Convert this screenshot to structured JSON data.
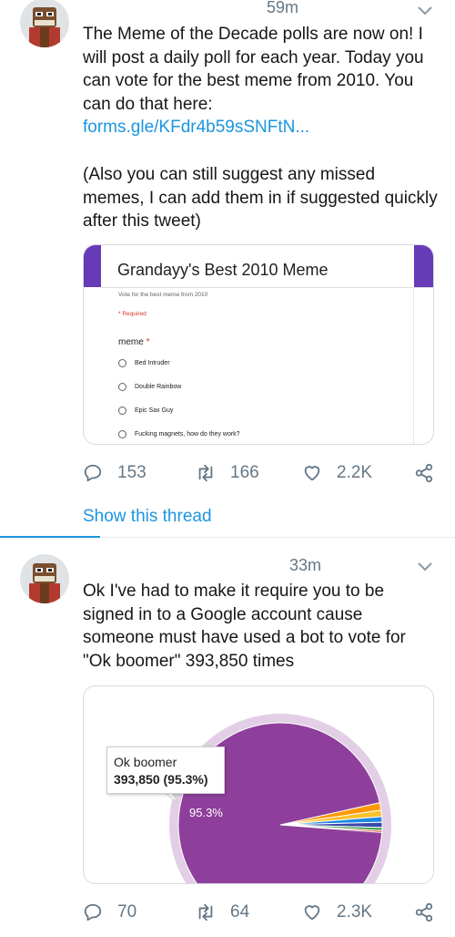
{
  "tweets": [
    {
      "time": "59m",
      "paragraphs": [
        "The Meme of the Decade polls are now on! I will post a daily poll for each year. Today you can vote for the best meme from 2010. You can do that here:",
        "(Also you can still suggest any missed memes, I can add them in if suggested quickly after this tweet)"
      ],
      "link": "forms.gle/KFdr4b59sSNFtN...",
      "form": {
        "title": "Grandayy's Best 2010 Meme",
        "subtitle": "Vote for the best meme from 2010",
        "required_note": "* Required",
        "question": "meme",
        "required_star": "*",
        "options": [
          "Bed Intruder",
          "Double Rainbow",
          "Epic Sax Guy",
          "Fucking magnets, how do they work?"
        ]
      },
      "actions": {
        "replies": "153",
        "retweets": "166",
        "likes": "2.2K"
      },
      "show_thread": "Show this thread"
    },
    {
      "time": "33m",
      "text": "Ok I've had to make it require you to be signed in to a Google account cause someone must have used a bot to vote for \"Ok boomer\" 393,850 times",
      "actions": {
        "replies": "70",
        "retweets": "64",
        "likes": "2.3K"
      }
    }
  ],
  "chart_data": {
    "type": "pie",
    "slices": [
      {
        "label": "Ok boomer",
        "value": 393850,
        "percent": 95.3,
        "color": "#8e3f9b"
      },
      {
        "label": "",
        "percent": 1.2,
        "color": "#ff9800"
      },
      {
        "label": "",
        "percent": 1.0,
        "color": "#fbc02d"
      },
      {
        "label": "",
        "percent": 0.9,
        "color": "#1e88e5"
      },
      {
        "label": "",
        "percent": 0.8,
        "color": "#3949ab"
      },
      {
        "label": "",
        "percent": 0.5,
        "color": "#43a047"
      },
      {
        "label": "",
        "percent": 0.3,
        "color": "#e53935"
      }
    ],
    "tooltip": {
      "label": "Ok boomer",
      "value_text": "393,850 (95.3%)"
    },
    "slice_label": "95.3%"
  },
  "colors": {
    "accent": "#1b95e0",
    "form_purple": "#673ab7",
    "muted": "#657786"
  },
  "icons": {
    "reply": "reply-icon",
    "retweet": "retweet-icon",
    "like": "heart-icon",
    "share": "share-icon",
    "menu": "chevron-down-icon"
  }
}
